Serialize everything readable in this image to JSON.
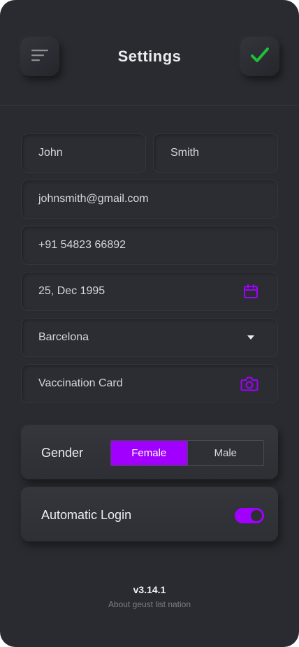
{
  "header": {
    "title": "Settings",
    "menu_icon": "menu-icon",
    "confirm_icon": "check-icon"
  },
  "form": {
    "first_name": "John",
    "last_name": "Smith",
    "email": "johnsmith@gmail.com",
    "phone": "+91 54823 66892",
    "dob": "25, Dec 1995",
    "dob_icon": "calendar-icon",
    "city": "Barcelona",
    "city_icon": "caret-down-icon",
    "document": "Vaccination Card",
    "document_icon": "camera-icon"
  },
  "gender": {
    "label": "Gender",
    "options": [
      "Female",
      "Male"
    ],
    "selected": "Female"
  },
  "auto_login": {
    "label": "Automatic Login",
    "enabled": true
  },
  "footer": {
    "version": "v3.14.1",
    "about": "About geust list nation"
  },
  "colors": {
    "background": "#2a2b30",
    "accent": "#a100ff",
    "check": "#1fbf3a",
    "text": "#d6d7dc"
  }
}
